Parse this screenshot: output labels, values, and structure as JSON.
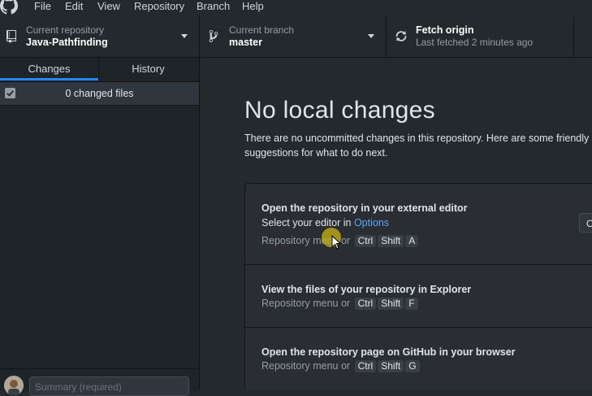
{
  "menubar": {
    "logo_icon": "github-logo-icon",
    "items": [
      "File",
      "Edit",
      "View",
      "Repository",
      "Branch",
      "Help"
    ]
  },
  "toolbar": {
    "repository": {
      "label": "Current repository",
      "value": "Java-Pathfinding",
      "icon": "repo-icon"
    },
    "branch": {
      "label": "Current branch",
      "value": "master",
      "icon": "branch-icon"
    },
    "fetch": {
      "label": "Fetch origin",
      "status": "Last fetched 2 minutes ago",
      "icon": "sync-icon"
    }
  },
  "sidebar": {
    "tabs": [
      {
        "label": "Changes",
        "selected": true
      },
      {
        "label": "History",
        "selected": false
      }
    ],
    "changes_count": "0 changed files",
    "summary_placeholder": "Summary (required)"
  },
  "main": {
    "title": "No local changes",
    "description": "There are no uncommitted changes in this repository. Here are some friendly suggestions for what to do next.",
    "suggestions": [
      {
        "title": "Open the repository in your external editor",
        "subtitle_prefix": "Select your editor in ",
        "subtitle_link": "Options",
        "shortcut_prefix": "Repository menu or",
        "keys": [
          "Ctrl",
          "Shift",
          "A"
        ],
        "button_label": "Open in Visual Studio Code"
      },
      {
        "title": "View the files of your repository in Explorer",
        "shortcut_prefix": "Repository menu or",
        "keys": [
          "Ctrl",
          "Shift",
          "F"
        ]
      },
      {
        "title": "Open the repository page on GitHub in your browser",
        "shortcut_prefix": "Repository menu or",
        "keys": [
          "Ctrl",
          "Shift",
          "G"
        ]
      }
    ]
  },
  "colors": {
    "accent": "#2188ff",
    "link": "#58a6ff",
    "background": "#24292e",
    "cursor_highlight": "#c8b414"
  }
}
